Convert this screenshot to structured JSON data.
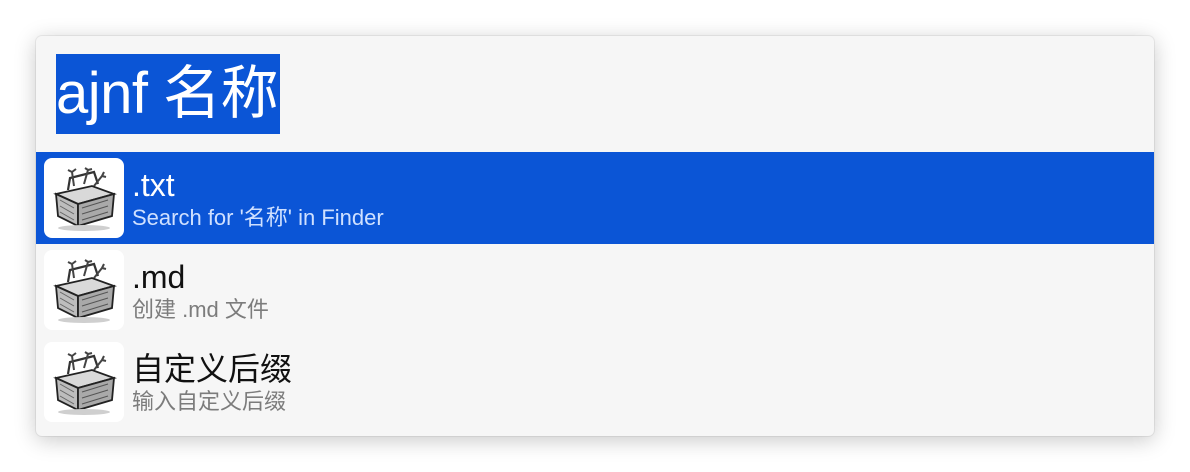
{
  "launcher": {
    "query": "ajnf 名称"
  },
  "results": [
    {
      "title": ".txt",
      "subtitle": "Search for '名称' in Finder",
      "icon": "toolbox-icon",
      "selected": true
    },
    {
      "title": ".md",
      "subtitle": "创建 .md 文件",
      "icon": "toolbox-icon",
      "selected": false
    },
    {
      "title": "自定义后缀",
      "subtitle": "输入自定义后缀",
      "icon": "toolbox-icon",
      "selected": false
    }
  ],
  "colors": {
    "selection": "#0b55d6",
    "background": "#f6f6f6"
  }
}
